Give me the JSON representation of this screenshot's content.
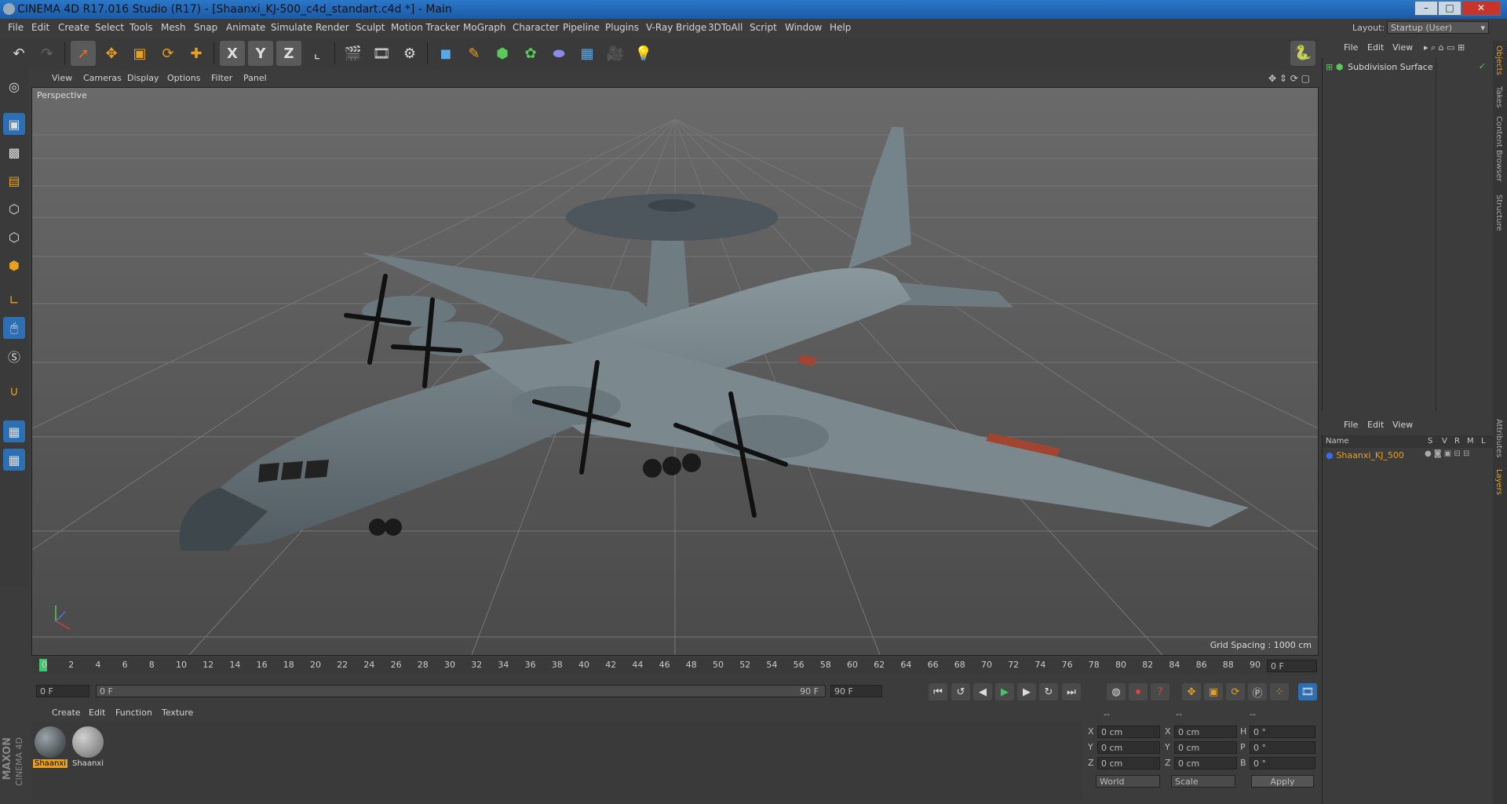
{
  "window": {
    "title": "CINEMA 4D R17.016 Studio (R17) - [Shaanxi_KJ-500_c4d_standart.c4d *] - Main",
    "btn_min": "–",
    "btn_max": "□",
    "btn_close": "✕"
  },
  "menubar": [
    "File",
    "Edit",
    "Create",
    "Select",
    "Tools",
    "Mesh",
    "Snap",
    "Animate",
    "Simulate",
    "Render",
    "Sculpt",
    "Motion Tracker",
    "MoGraph",
    "Character",
    "Pipeline",
    "Plugins",
    "V-Ray Bridge",
    "3DToAll",
    "Script",
    "Window",
    "Help"
  ],
  "layout": {
    "label": "Layout:",
    "value": "Startup (User)"
  },
  "toolbar": {
    "x": "X",
    "y": "Y",
    "z": "Z"
  },
  "viewport": {
    "menu": [
      "View",
      "Cameras",
      "Display",
      "Options",
      "Filter",
      "Panel"
    ],
    "camera": "Perspective",
    "grid_spacing": "Grid Spacing : 1000 cm"
  },
  "timeline": {
    "ticks": [
      "0",
      "2",
      "4",
      "6",
      "8",
      "10",
      "12",
      "14",
      "16",
      "18",
      "20",
      "22",
      "24",
      "26",
      "28",
      "30",
      "32",
      "34",
      "36",
      "38",
      "40",
      "42",
      "44",
      "46",
      "48",
      "50",
      "52",
      "54",
      "56",
      "58",
      "60",
      "62",
      "64",
      "66",
      "68",
      "70",
      "72",
      "74",
      "76",
      "78",
      "80",
      "82",
      "84",
      "86",
      "88",
      "90"
    ],
    "current_frame": "0 F",
    "start": "0 F",
    "slider_start": "0 F",
    "slider_end": "90 F",
    "end": "90 F"
  },
  "materials": {
    "menu": [
      "Create",
      "Edit",
      "Function",
      "Texture"
    ],
    "items": [
      {
        "name": "Shaanxi"
      },
      {
        "name": "Shaanxi"
      }
    ]
  },
  "coords": {
    "headers": [
      "--",
      "--",
      "--"
    ],
    "rows": [
      {
        "a": "X",
        "av": "0 cm",
        "b": "X",
        "bv": "0 cm",
        "c": "H",
        "cv": "0 °"
      },
      {
        "a": "Y",
        "av": "0 cm",
        "b": "Y",
        "bv": "0 cm",
        "c": "P",
        "cv": "0 °"
      },
      {
        "a": "Z",
        "av": "0 cm",
        "b": "Z",
        "bv": "0 cm",
        "c": "B",
        "cv": "0 °"
      }
    ],
    "world": "World",
    "scale": "Scale",
    "apply": "Apply"
  },
  "objects": {
    "menu": [
      "File",
      "Edit",
      "View"
    ],
    "items": [
      {
        "name": "Subdivision Surface"
      }
    ]
  },
  "layers": {
    "menu": [
      "File",
      "Edit",
      "View"
    ],
    "columns": [
      "Name",
      "S",
      "V",
      "R",
      "M",
      "L"
    ],
    "items": [
      {
        "name": "Shaanxi_KJ_500"
      }
    ]
  },
  "sidetabs": [
    "Objects",
    "Takes",
    "Content Browser",
    "Structure",
    "Attributes",
    "Layers"
  ],
  "logo": {
    "line1": "MAXON",
    "line2": "CINEMA 4D"
  },
  "colors": {
    "accent": "#2d6fb3",
    "highlight": "#e8a020",
    "viewport_bg": "#5c5c5c"
  }
}
